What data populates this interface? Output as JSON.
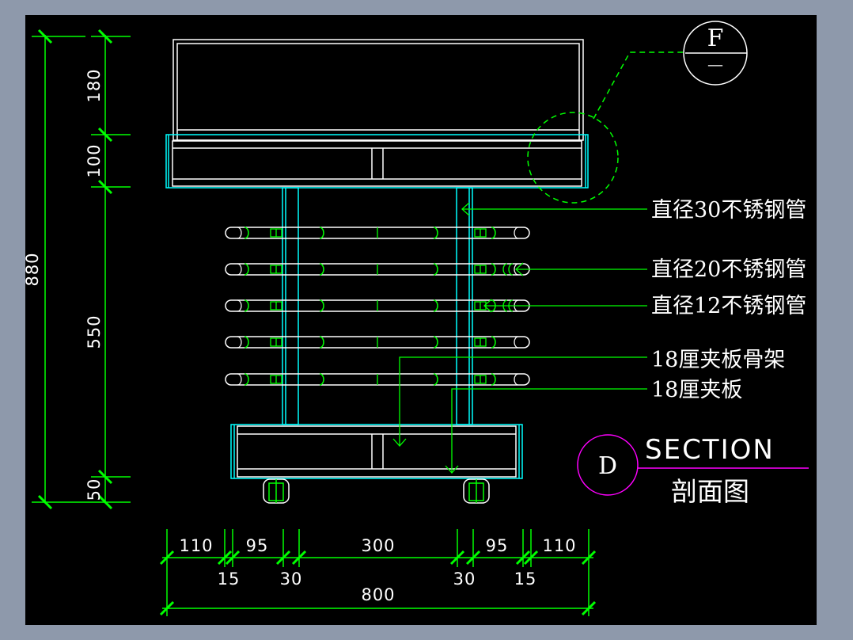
{
  "drawing": {
    "colors": {
      "background": "#000000",
      "frame": "#8e99ab",
      "line": "#ffffff",
      "dimension": "#00ff00",
      "leader": "#00ff00",
      "tube": "#00ffff",
      "section_symbol": "#ff00ff"
    },
    "vertical_dims": {
      "overall": "880",
      "segments": [
        "180",
        "100",
        "550",
        "50"
      ]
    },
    "horizontal_dims": {
      "top_row": [
        "110",
        "95",
        "300",
        "95",
        "110"
      ],
      "bottom_row": [
        "15",
        "30",
        "30",
        "15"
      ],
      "overall": "800"
    },
    "callouts": [
      "直径30不锈钢管",
      "直径20不锈钢管",
      "直径12不锈钢管",
      "18厘夹板骨架",
      "18厘夹板"
    ],
    "detail_marker": {
      "letter": "F",
      "sub": "—"
    },
    "section": {
      "letter": "D",
      "title": "SECTION",
      "subtitle": "剖面图"
    }
  }
}
